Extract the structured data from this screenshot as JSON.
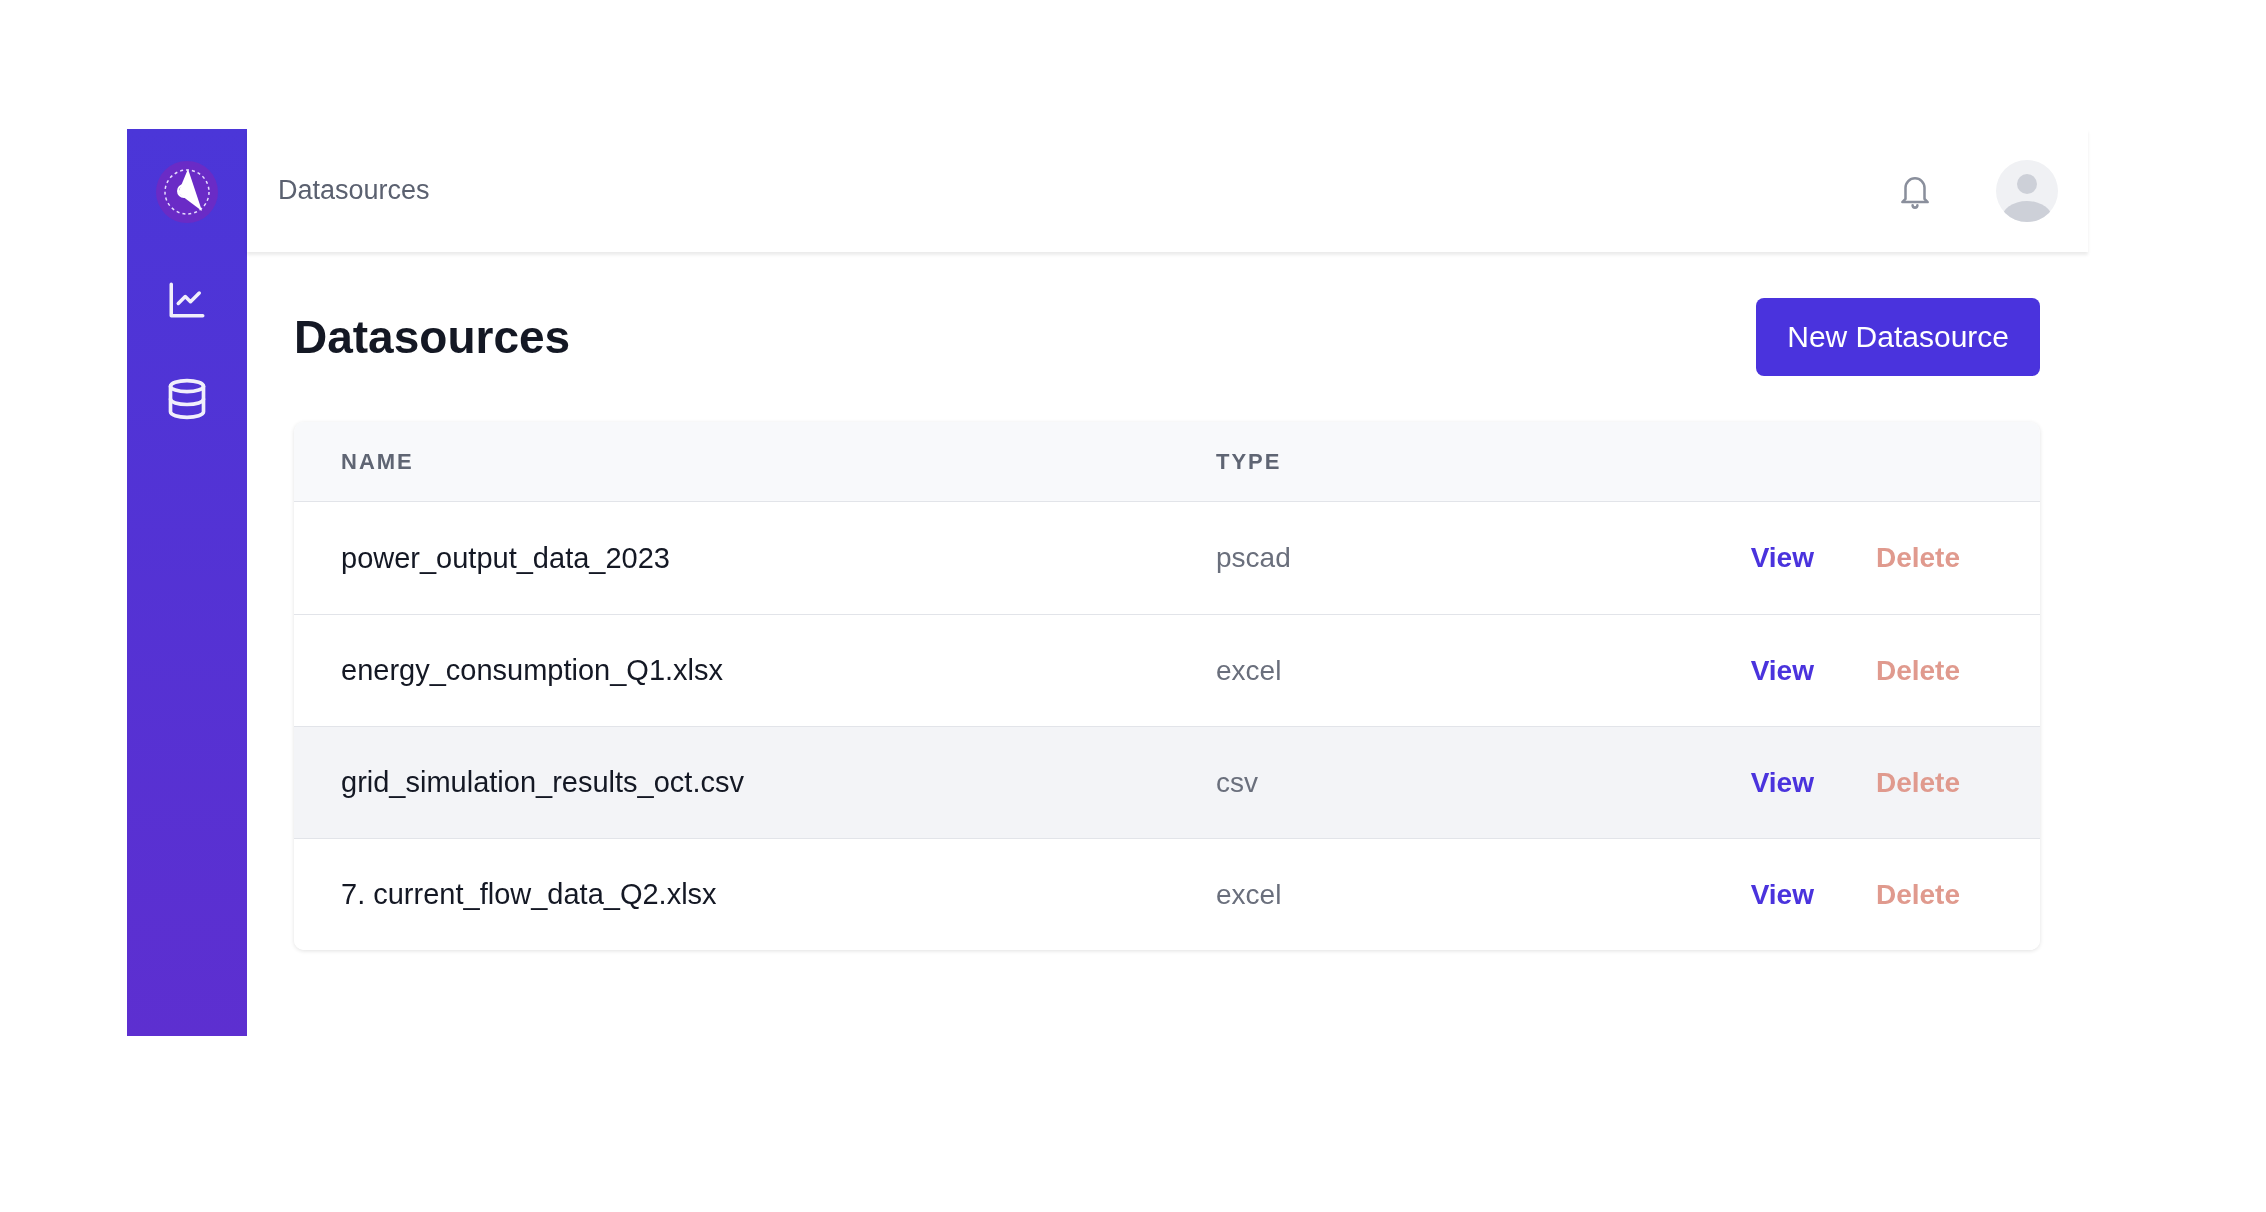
{
  "topbar": {
    "title": "Datasources"
  },
  "page": {
    "heading": "Datasources",
    "primary_button": "New Datasource"
  },
  "table": {
    "columns": [
      "NAME",
      "TYPE"
    ],
    "rows": [
      {
        "name": "power_output_data_2023",
        "type": "pscad",
        "actions": [
          "View",
          "Delete"
        ],
        "highlighted": false
      },
      {
        "name": "energy_consumption_Q1.xlsx",
        "type": "excel",
        "actions": [
          "View",
          "Delete"
        ],
        "highlighted": false
      },
      {
        "name": "grid_simulation_results_oct.csv",
        "type": "csv",
        "actions": [
          "View",
          "Delete"
        ],
        "highlighted": true
      },
      {
        "name": "7. current_flow_data_Q2.xlsx",
        "type": "excel",
        "actions": [
          "View",
          "Delete"
        ],
        "highlighted": false
      }
    ]
  }
}
